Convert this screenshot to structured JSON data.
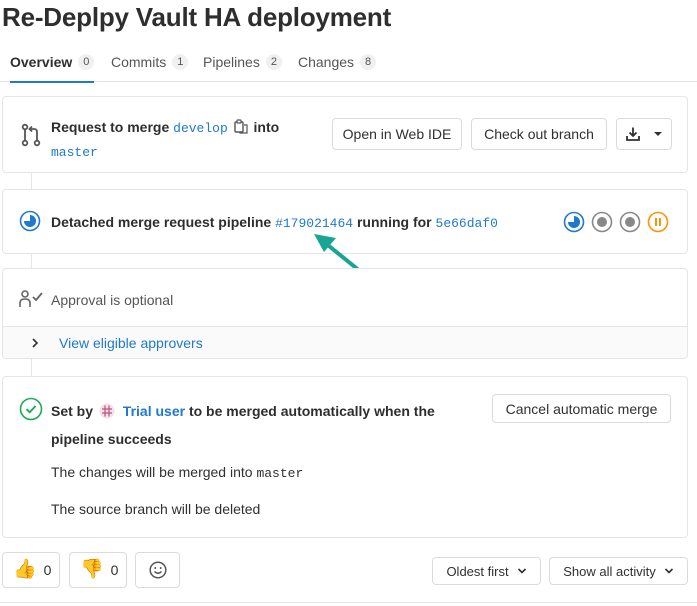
{
  "page": {
    "title": "Re-Deplpy Vault HA deployment"
  },
  "tabs": [
    {
      "label": "Overview",
      "count": "0"
    },
    {
      "label": "Commits",
      "count": "1"
    },
    {
      "label": "Pipelines",
      "count": "2"
    },
    {
      "label": "Changes",
      "count": "8"
    }
  ],
  "merge_request": {
    "request_prefix": "Request to merge",
    "source_branch": "develop",
    "into_text": "into",
    "target_branch": "master",
    "open_web_ide_label": "Open in Web IDE",
    "checkout_label": "Check out branch"
  },
  "pipeline": {
    "prefix": "Detached merge request pipeline",
    "id": "#179021464",
    "running_text": "running for",
    "commit": "5e66daf0",
    "stage_statuses": [
      "running",
      "created",
      "created",
      "paused"
    ]
  },
  "approval": {
    "text": "Approval is optional",
    "view_approvers_label": "View eligible approvers"
  },
  "auto_merge": {
    "set_by": "Set by",
    "user": "Trial user",
    "suffix": "to be merged automatically when the",
    "line2": "pipeline succeeds",
    "cancel_label": "Cancel automatic merge",
    "merged_into_text": "The changes will be merged into",
    "merged_into_branch": "master",
    "source_deleted_text": "The source branch will be deleted"
  },
  "reactions": {
    "thumbs_up": "👍",
    "thumbs_up_count": "0",
    "thumbs_down": "👎",
    "thumbs_down_count": "0"
  },
  "activity": {
    "sort_label": "Oldest first",
    "filter_label": "Show all activity"
  },
  "colors": {
    "link": "#1f78d1",
    "running": "#1f78d1",
    "created": "#888888",
    "paused": "#fc9403",
    "success": "#1aaa55",
    "annotation_arrow": "#1aa592"
  }
}
